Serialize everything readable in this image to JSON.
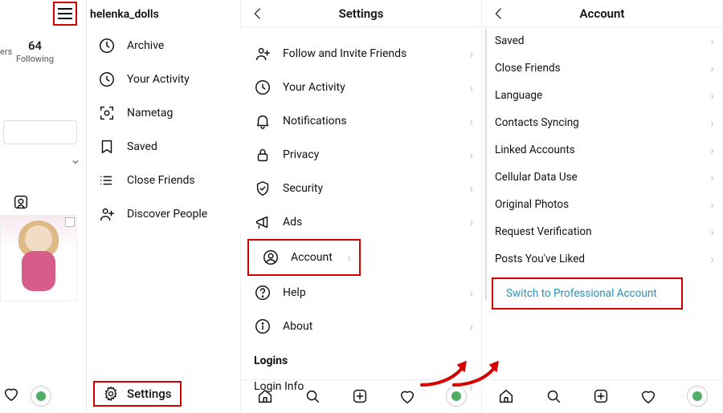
{
  "panel1": {
    "username": "helenka_dolls",
    "following_count": "64",
    "following_label": "Following",
    "ers_fragment": "ers",
    "drawer": [
      {
        "label": "Archive"
      },
      {
        "label": "Your Activity"
      },
      {
        "label": "Nametag"
      },
      {
        "label": "Saved"
      },
      {
        "label": "Close Friends"
      },
      {
        "label": "Discover People"
      }
    ],
    "settings_label": "Settings"
  },
  "panel2": {
    "title": "Settings",
    "items": [
      {
        "label": "Follow and Invite Friends"
      },
      {
        "label": "Your Activity"
      },
      {
        "label": "Notifications"
      },
      {
        "label": "Privacy"
      },
      {
        "label": "Security"
      },
      {
        "label": "Ads"
      },
      {
        "label": "Account"
      },
      {
        "label": "Help"
      },
      {
        "label": "About"
      }
    ],
    "section_logins": "Logins",
    "login_info": "Login Info"
  },
  "panel3": {
    "title": "Account",
    "items": [
      {
        "label": "Saved"
      },
      {
        "label": "Close Friends"
      },
      {
        "label": "Language"
      },
      {
        "label": "Contacts Syncing"
      },
      {
        "label": "Linked Accounts"
      },
      {
        "label": "Cellular Data Use"
      },
      {
        "label": "Original Photos"
      },
      {
        "label": "Request Verification"
      },
      {
        "label": "Posts You've Liked"
      }
    ],
    "switch_label": "Switch to Professional Account"
  },
  "colors": {
    "highlight": "#d40000",
    "link": "#2792c3"
  }
}
